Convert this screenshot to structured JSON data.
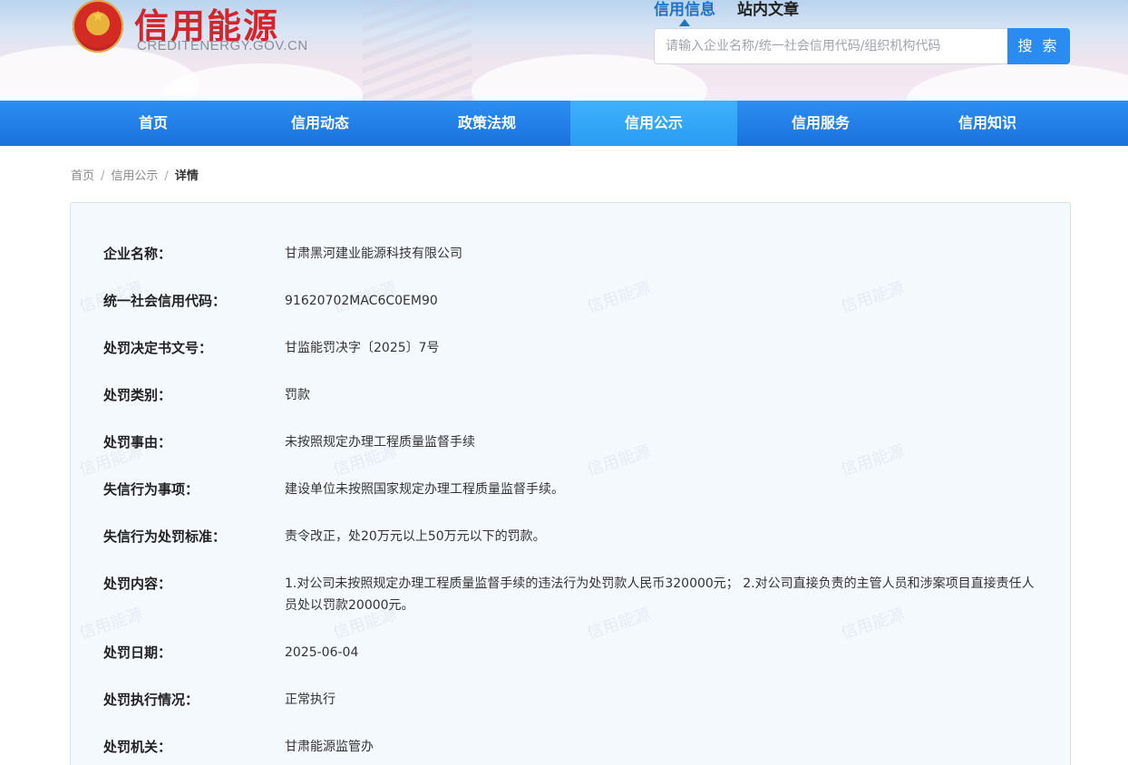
{
  "header": {
    "logo_title": "信用能源",
    "logo_subtitle": "CREDITENERGY.GOV.CN",
    "search_tabs": [
      "信用信息",
      "站内文章"
    ],
    "search_placeholder": "请输入企业名称/统一社会信用代码/组织机构代码",
    "search_button": "搜 索"
  },
  "nav": {
    "items": [
      "首页",
      "信用动态",
      "政策法规",
      "信用公示",
      "信用服务",
      "信用知识"
    ],
    "active_index": 3
  },
  "breadcrumb": [
    "首页",
    "信用公示",
    "详情"
  ],
  "watermark": "信用能源",
  "detail": [
    {
      "label": "企业名称：",
      "value": "甘肃黑河建业能源科技有限公司"
    },
    {
      "label": "统一社会信用代码：",
      "value": "91620702MAC6C0EM90"
    },
    {
      "label": "处罚决定书文号：",
      "value": "甘监能罚决字〔2025〕7号"
    },
    {
      "label": "处罚类别：",
      "value": "罚款"
    },
    {
      "label": "处罚事由：",
      "value": "未按照规定办理工程质量监督手续"
    },
    {
      "label": "失信行为事项：",
      "value": "建设单位未按照国家规定办理工程质量监督手续。"
    },
    {
      "label": "失信行为处罚标准：",
      "value": "责令改正，处20万元以上50万元以下的罚款。"
    },
    {
      "label": "处罚内容：",
      "value": "1.对公司未按照规定办理工程质量监督手续的违法行为处罚款人民币320000元； 2.对公司直接负责的主管人员和涉案项目直接责任人员处以罚款20000元。"
    },
    {
      "label": "处罚日期：",
      "value": "2025-06-04"
    },
    {
      "label": "处罚执行情况：",
      "value": "正常执行"
    },
    {
      "label": "处罚机关：",
      "value": "甘肃能源监管办"
    }
  ],
  "colors": {
    "accent": "#1d72c8",
    "nav_bg": "#1f7be5",
    "nav_active": "#33a6f7",
    "brand_red": "#d3262c",
    "search_button": "#2a8bf0"
  }
}
